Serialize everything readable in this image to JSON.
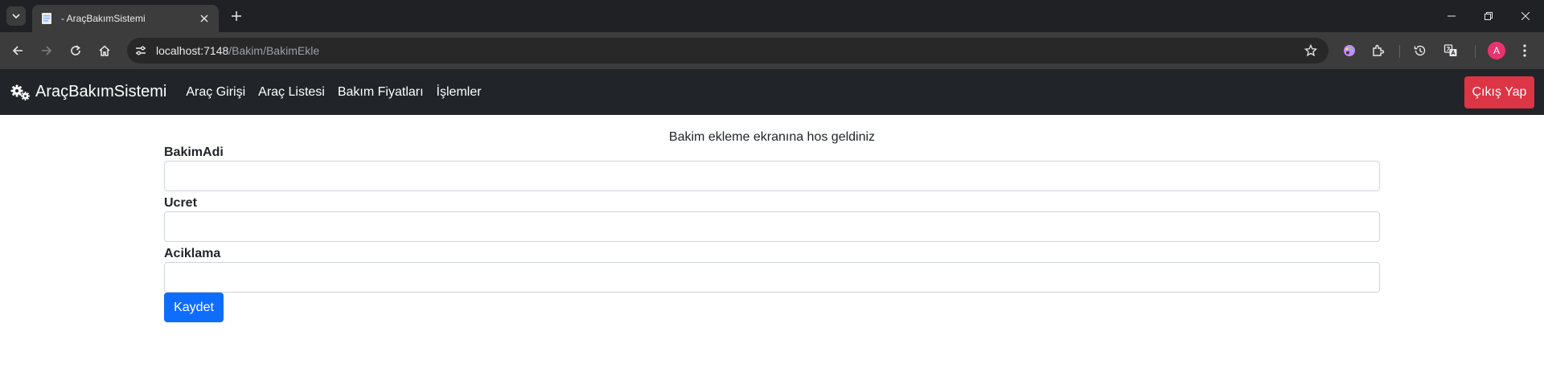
{
  "browser": {
    "tab_title": "- AraçBakımSistemi",
    "url_host": "localhost:7148",
    "url_path": "/Bakim/BakimEkle",
    "avatar_letter": "A"
  },
  "navbar": {
    "brand": "AraçBakımSistemi",
    "links": [
      "Araç Girişi",
      "Araç Listesi",
      "Bakım Fiyatları",
      "İşlemler"
    ],
    "logout_label": "Çıkış Yap",
    "logout_color": "#dc3545",
    "background": "#212529"
  },
  "form": {
    "welcome": "Bakim ekleme ekranına hos geldiniz",
    "fields": [
      {
        "label": "BakimAdi",
        "value": ""
      },
      {
        "label": "Ucret",
        "value": ""
      },
      {
        "label": "Aciklama",
        "value": ""
      }
    ],
    "submit_label": "Kaydet",
    "submit_color": "#0d6efd"
  }
}
